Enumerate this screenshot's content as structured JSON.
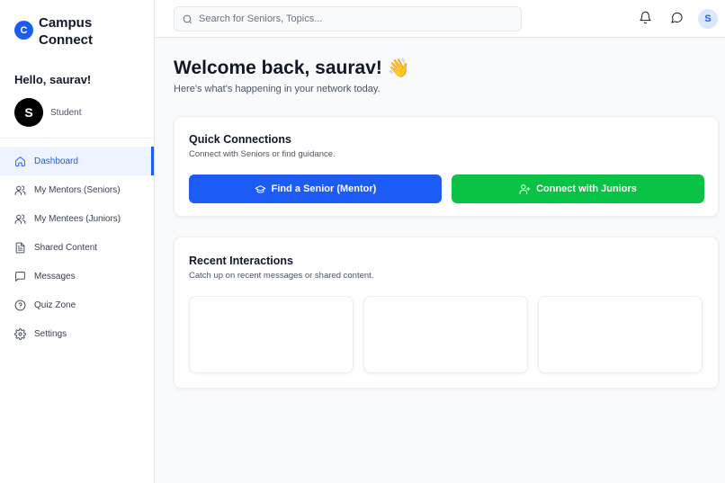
{
  "brand": {
    "logo_letter": "C",
    "name": "Campus Connect"
  },
  "user": {
    "greeting": "Hello, saurav!",
    "avatar_letter": "S",
    "role": "Student"
  },
  "nav": {
    "items": [
      {
        "label": "Dashboard",
        "icon": "home-icon",
        "active": true
      },
      {
        "label": "My Mentors (Seniors)",
        "icon": "users-icon"
      },
      {
        "label": "My Mentees (Juniors)",
        "icon": "users-icon"
      },
      {
        "label": "Shared Content",
        "icon": "document-icon"
      },
      {
        "label": "Messages",
        "icon": "message-icon"
      },
      {
        "label": "Quiz Zone",
        "icon": "help-circle-icon"
      },
      {
        "label": "Settings",
        "icon": "gear-icon"
      }
    ]
  },
  "topbar": {
    "search_placeholder": "Search for Seniors, Topics...",
    "search_value": "",
    "avatar_letter": "S"
  },
  "main": {
    "welcome": "Welcome back, saurav!",
    "wave": "👋",
    "subtitle": "Here's what's happening in your network today."
  },
  "quick_connections": {
    "title": "Quick Connections",
    "description": "Connect with Seniors or find guidance.",
    "find_senior_label": "Find a Senior (Mentor)",
    "connect_juniors_label": "Connect with Juniors"
  },
  "recent_interactions": {
    "title": "Recent Interactions",
    "description": "Catch up on recent messages or shared content."
  },
  "colors": {
    "accent": "#1d5bf5",
    "success": "#0ac244",
    "active_bg": "#eef4ff"
  }
}
